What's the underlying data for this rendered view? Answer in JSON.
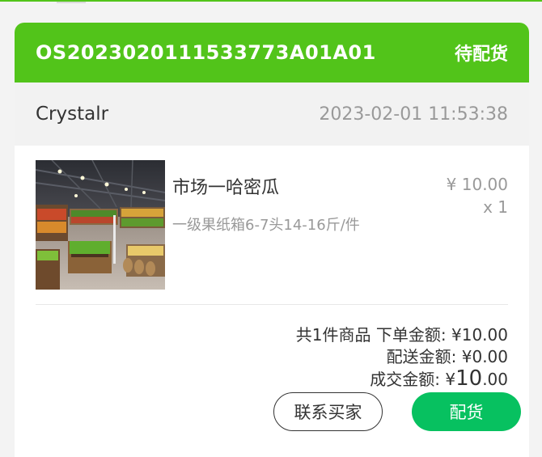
{
  "order": {
    "number": "OS2023020111533773A01A01",
    "status": "待配货",
    "buyer": "Crystalr",
    "time": "2023-02-01 11:53:38"
  },
  "product": {
    "name": "市场一哈密瓜",
    "spec": "一级果纸箱6-7头14-16斤/件",
    "price": "¥ 10.00",
    "quantity": "x 1",
    "image": "supermarket-produce-photo"
  },
  "summary": {
    "item_count_label": "共1件商品",
    "order_amount_label": "下单金额:",
    "order_amount_currency": "¥",
    "order_amount_value": "10.00",
    "delivery_fee_label": "配送金额:",
    "delivery_fee_currency": "¥",
    "delivery_fee_value": "0.00",
    "deal_amount_label": "成交金额:",
    "deal_amount_currency": "¥",
    "deal_amount_integer": "10",
    "deal_amount_decimal": ".00"
  },
  "actions": {
    "contact_buyer": "联系买家",
    "dispatch": "配货"
  },
  "colors": {
    "header_green": "#52c41a",
    "button_green": "#07c160"
  }
}
